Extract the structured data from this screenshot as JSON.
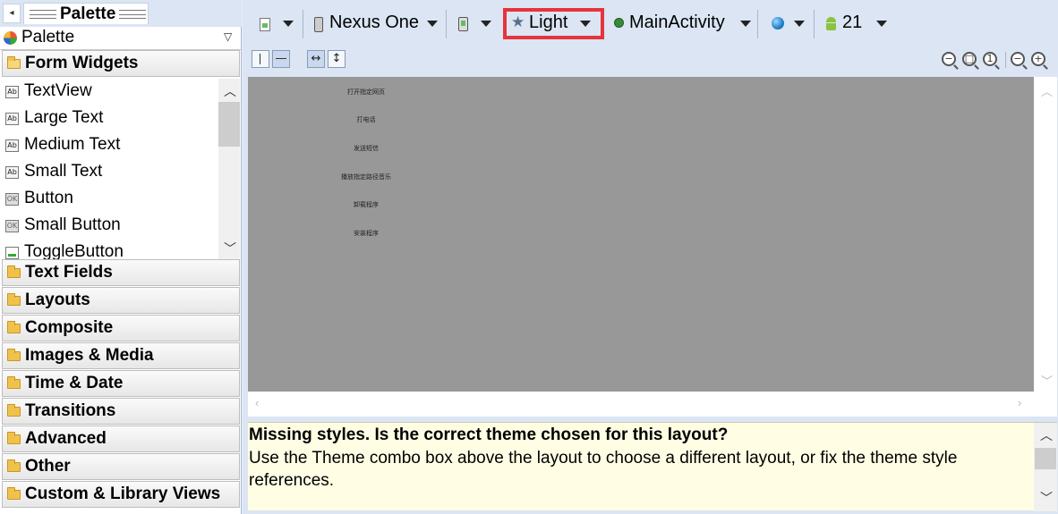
{
  "palette": {
    "tab_title": "Palette",
    "collapse_glyph": "◂",
    "selector_label": "Palette",
    "selector_arrow": "▽",
    "open_category": "Form Widgets",
    "widgets": [
      {
        "icon": "Ab",
        "label": "TextView"
      },
      {
        "icon": "Ab",
        "label": "Large Text"
      },
      {
        "icon": "Ab",
        "label": "Medium Text"
      },
      {
        "icon": "Ab",
        "label": "Small Text"
      },
      {
        "icon": "OK",
        "label": "Button"
      },
      {
        "icon": "OK",
        "label": "Small Button"
      },
      {
        "icon": "",
        "label": "ToggleButton"
      }
    ],
    "categories": [
      "Text Fields",
      "Layouts",
      "Composite",
      "Images & Media",
      "Time & Date",
      "Transitions",
      "Advanced",
      "Other",
      "Custom & Library Views"
    ]
  },
  "toolbar": {
    "device": "Nexus One",
    "theme": "Light",
    "activity": "MainActivity",
    "api_level": "21",
    "highlight_color": "#e8333a"
  },
  "canvas": {
    "items": [
      "打开指定网页",
      "打电话",
      "发送短信",
      "播放指定路径音乐",
      "卸载程序",
      "安装程序"
    ],
    "background": "#989898"
  },
  "message": {
    "title": "Missing styles. Is the correct theme chosen for this layout?",
    "body": "Use the Theme combo box above the layout to choose a different layout, or fix the theme style references."
  },
  "glyphs": {
    "up": "︿",
    "down": "﹀",
    "left": "‹",
    "right": "›",
    "arrows_h": "↔",
    "arrows_v": "↕",
    "star": "★",
    "zoom_out": "−",
    "zoom_fit": "□",
    "zoom_actual": "1",
    "zoom_out2": "−",
    "zoom_in": "+"
  }
}
